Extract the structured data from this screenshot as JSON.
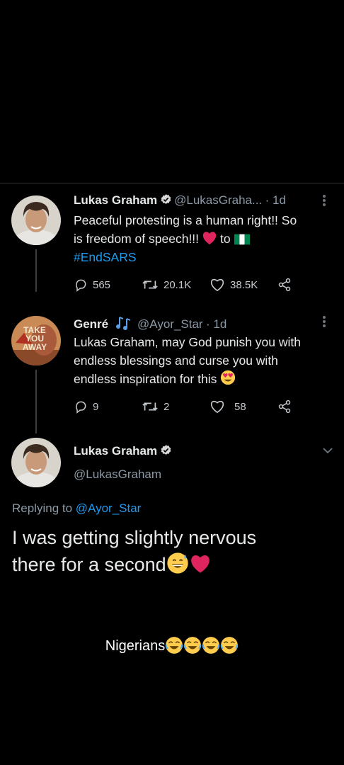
{
  "tweet1": {
    "name": "Lukas Graham",
    "handle": "@LukasGraha...",
    "time": "· 1d",
    "text_line1": "Peaceful protesting is a human right!! So",
    "text_line2_a": "is freedom of speech!!!",
    "text_line2_b": "to",
    "hashtag": "#EndSARS",
    "replies": "565",
    "retweets": "20.1K",
    "likes": "38.5K"
  },
  "tweet2": {
    "name": "Genré",
    "handle": "@Ayor_Star",
    "time": "· 1d",
    "avatar_text": [
      "TAKE",
      "YOU",
      "AWAY"
    ],
    "text_lines": [
      "Lukas Graham, may God punish you with",
      "endless blessings and curse you with",
      "endless inspiration for this"
    ],
    "replies": "9",
    "retweets": "2",
    "likes": "58"
  },
  "tweet3": {
    "name": "Lukas Graham",
    "handle": "@LukasGraham",
    "replying_prefix": "Replying to",
    "replying_handle": "@Ayor_Star",
    "text_line1": "I was getting slightly nervous",
    "text_line2": "there for a second"
  },
  "caption": "Nigerians",
  "colors": {
    "background": "#000000",
    "link": "#1d9bf0",
    "heart": "#e0245e",
    "muted": "#8b98a5"
  },
  "icons": [
    "verified-icon",
    "reply-icon",
    "retweet-icon",
    "like-icon",
    "share-icon",
    "more-icon",
    "chevron-down-icon",
    "heart-emoji",
    "nigeria-flag",
    "music-notes",
    "heart-eyes-emoji",
    "sweat-smile-emoji",
    "joy-emoji"
  ]
}
